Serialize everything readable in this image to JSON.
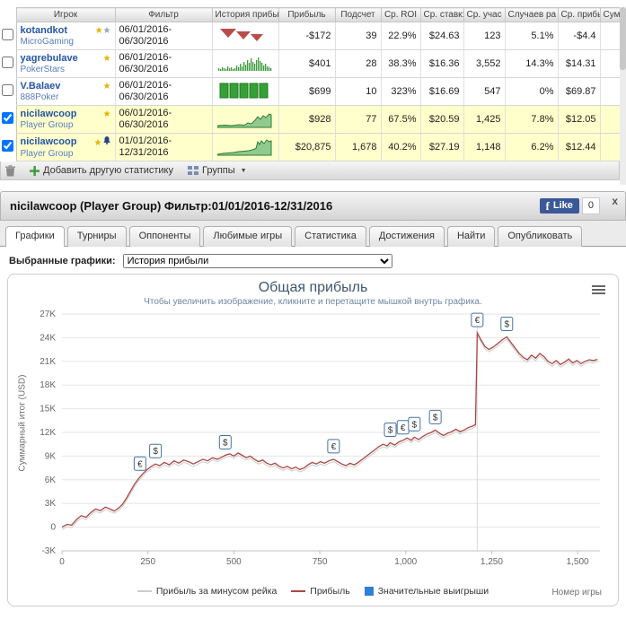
{
  "table": {
    "headers": [
      "Игрок",
      "Фильтр",
      "История прибы",
      "Прибыль",
      "Подсчет",
      "Ср. ROI",
      "Ср. ставк:",
      "Ср. учас",
      "Случаев ра",
      "Ср. прибы",
      "Сумм"
    ],
    "rows": [
      {
        "name": "kotandkot",
        "site": "MicroGaming",
        "icons": [
          "gold-star",
          "gray-star"
        ],
        "filter": "06/01/2016-06/30/2016",
        "spark": "red-wedges",
        "checked": false,
        "neg": [
          "profit",
          "avg_profit"
        ],
        "cells": {
          "profit": "-$172",
          "count": "39",
          "roi": "22.9%",
          "stake": "$24.63",
          "entrants": "123",
          "overlay": "5.1%",
          "avg_profit": "-$4.4",
          "sum": ""
        }
      },
      {
        "name": "yagrebulave",
        "site": "PokerStars",
        "icons": [
          "gold-star"
        ],
        "filter": "06/01/2016-06/30/2016",
        "spark": "green-bars",
        "checked": false,
        "neg": [],
        "cells": {
          "profit": "$401",
          "count": "28",
          "roi": "38.3%",
          "stake": "$16.36",
          "entrants": "3,552",
          "overlay": "14.3%",
          "avg_profit": "$14.31",
          "sum": ""
        }
      },
      {
        "name": "V.Balaev",
        "site": "888Poker",
        "icons": [
          "gold-star"
        ],
        "filter": "06/01/2016-06/30/2016",
        "spark": "green-blocks",
        "checked": false,
        "neg": [],
        "cells": {
          "profit": "$699",
          "count": "10",
          "roi": "323%",
          "stake": "$16.69",
          "entrants": "547",
          "overlay": "0%",
          "avg_profit": "$69.87",
          "sum": ""
        }
      },
      {
        "name": "nicilawcoop",
        "site": "Player Group",
        "icons": [
          "gold-star"
        ],
        "filter": "06/01/2016-06/30/2016",
        "spark": "area-a",
        "checked": true,
        "neg": [],
        "cells": {
          "profit": "$928",
          "count": "77",
          "roi": "67.5%",
          "stake": "$20.59",
          "entrants": "1,425",
          "overlay": "7.8%",
          "avg_profit": "$12.05",
          "sum": ""
        }
      },
      {
        "name": "nicilawcoop",
        "site": "Player Group",
        "icons": [
          "gold-star",
          "bell"
        ],
        "filter": "01/01/2016-12/31/2016",
        "spark": "area-b",
        "checked": true,
        "neg": [],
        "cells": {
          "profit": "$20,875",
          "count": "1,678",
          "roi": "40.2%",
          "stake": "$27.19",
          "entrants": "1,148",
          "overlay": "6.2%",
          "avg_profit": "$12.44",
          "sum": ""
        }
      }
    ]
  },
  "toolbar": {
    "add_label": "Добавить другую статистику",
    "groups_label": "Группы"
  },
  "panel": {
    "title": "nicilawcoop (Player Group) Фильтр:01/01/2016-12/31/2016",
    "like_f": "f",
    "like_label": "Like",
    "like_count": "0",
    "close_label": "x",
    "tabs": [
      "Графики",
      "Турниры",
      "Оппоненты",
      "Любимые игры",
      "Статистика",
      "Достижения",
      "Найти",
      "Опубликовать"
    ],
    "active_tab": "Графики",
    "selector_label": "Выбранные графики:",
    "selector_value": "История прибыли"
  },
  "chart_data": {
    "type": "line",
    "title": "Общая прибыль",
    "subtitle": "Чтобы увеличить изображение, кликните и перетащите мышкой внутрь графика.",
    "ylabel": "Суммарный итог (USD)",
    "xlabel": "Номер игры",
    "xlim": [
      0,
      1565
    ],
    "ylim": [
      -3000,
      27000
    ],
    "yticks": [
      {
        "v": -3000,
        "label": "-3K"
      },
      {
        "v": 0,
        "label": "0"
      },
      {
        "v": 3000,
        "label": "3K"
      },
      {
        "v": 6000,
        "label": "6K"
      },
      {
        "v": 9000,
        "label": "9K"
      },
      {
        "v": 12000,
        "label": "12K"
      },
      {
        "v": 15000,
        "label": "15K"
      },
      {
        "v": 18000,
        "label": "18K"
      },
      {
        "v": 21000,
        "label": "21K"
      },
      {
        "v": 24000,
        "label": "24K"
      },
      {
        "v": 27000,
        "label": "27K"
      }
    ],
    "xticks": [
      {
        "v": 0,
        "label": "0"
      },
      {
        "v": 250,
        "label": "250"
      },
      {
        "v": 500,
        "label": "500"
      },
      {
        "v": 750,
        "label": "750"
      },
      {
        "v": 1000,
        "label": "1,000"
      },
      {
        "v": 1250,
        "label": "1,250"
      },
      {
        "v": 1500,
        "label": "1,500"
      }
    ],
    "vline_x": 1208,
    "marker_border": "#4572A7",
    "series": [
      {
        "name": "Прибыль за минусом рейка",
        "color": "#CCCCCC",
        "offset": -300,
        "width": 1
      },
      {
        "name": "Прибыль",
        "color": "#AA4643",
        "offset": 0,
        "width": 1.3
      }
    ],
    "points": [
      [
        0,
        0
      ],
      [
        15,
        350
      ],
      [
        28,
        250
      ],
      [
        42,
        950
      ],
      [
        56,
        1450
      ],
      [
        70,
        1250
      ],
      [
        84,
        1850
      ],
      [
        98,
        2300
      ],
      [
        112,
        2100
      ],
      [
        126,
        2550
      ],
      [
        140,
        2300
      ],
      [
        152,
        2050
      ],
      [
        164,
        2400
      ],
      [
        176,
        2900
      ],
      [
        188,
        3700
      ],
      [
        200,
        4600
      ],
      [
        212,
        5500
      ],
      [
        224,
        6200
      ],
      [
        236,
        6800
      ],
      [
        248,
        7300
      ],
      [
        260,
        7700
      ],
      [
        272,
        8000
      ],
      [
        284,
        7800
      ],
      [
        298,
        8200
      ],
      [
        312,
        7900
      ],
      [
        326,
        8400
      ],
      [
        340,
        8100
      ],
      [
        354,
        8500
      ],
      [
        368,
        8300
      ],
      [
        382,
        8000
      ],
      [
        396,
        8300
      ],
      [
        410,
        8600
      ],
      [
        424,
        8400
      ],
      [
        438,
        8800
      ],
      [
        452,
        8600
      ],
      [
        466,
        8900
      ],
      [
        475,
        9100
      ],
      [
        488,
        9300
      ],
      [
        500,
        9000
      ],
      [
        512,
        9400
      ],
      [
        524,
        9100
      ],
      [
        536,
        8800
      ],
      [
        548,
        9000
      ],
      [
        560,
        8600
      ],
      [
        572,
        8300
      ],
      [
        584,
        8500
      ],
      [
        596,
        8100
      ],
      [
        608,
        7900
      ],
      [
        620,
        8100
      ],
      [
        632,
        7700
      ],
      [
        644,
        7500
      ],
      [
        656,
        7700
      ],
      [
        668,
        7400
      ],
      [
        680,
        7600
      ],
      [
        692,
        7300
      ],
      [
        704,
        7500
      ],
      [
        716,
        7900
      ],
      [
        728,
        8200
      ],
      [
        740,
        8000
      ],
      [
        752,
        8300
      ],
      [
        764,
        8100
      ],
      [
        776,
        8400
      ],
      [
        790,
        8600
      ],
      [
        802,
        8300
      ],
      [
        814,
        8000
      ],
      [
        826,
        7800
      ],
      [
        838,
        8100
      ],
      [
        850,
        7900
      ],
      [
        862,
        8200
      ],
      [
        874,
        8600
      ],
      [
        886,
        9000
      ],
      [
        898,
        9400
      ],
      [
        910,
        9800
      ],
      [
        922,
        10200
      ],
      [
        934,
        10500
      ],
      [
        946,
        10300
      ],
      [
        955,
        10700
      ],
      [
        968,
        10400
      ],
      [
        980,
        10800
      ],
      [
        992,
        11000
      ],
      [
        1004,
        11300
      ],
      [
        1016,
        11000
      ],
      [
        1025,
        11400
      ],
      [
        1038,
        11100
      ],
      [
        1050,
        11500
      ],
      [
        1062,
        11800
      ],
      [
        1074,
        12000
      ],
      [
        1086,
        12300
      ],
      [
        1098,
        11900
      ],
      [
        1110,
        11600
      ],
      [
        1122,
        11900
      ],
      [
        1134,
        12100
      ],
      [
        1146,
        12400
      ],
      [
        1158,
        12100
      ],
      [
        1170,
        12300
      ],
      [
        1182,
        12600
      ],
      [
        1194,
        12800
      ],
      [
        1203,
        13000
      ],
      [
        1208,
        24600
      ],
      [
        1218,
        23800
      ],
      [
        1230,
        22900
      ],
      [
        1242,
        22500
      ],
      [
        1254,
        22800
      ],
      [
        1266,
        23200
      ],
      [
        1280,
        23700
      ],
      [
        1294,
        24100
      ],
      [
        1306,
        23400
      ],
      [
        1318,
        22700
      ],
      [
        1330,
        22000
      ],
      [
        1342,
        21500
      ],
      [
        1354,
        21200
      ],
      [
        1366,
        21800
      ],
      [
        1378,
        21400
      ],
      [
        1390,
        22000
      ],
      [
        1402,
        21600
      ],
      [
        1414,
        21000
      ],
      [
        1426,
        20700
      ],
      [
        1438,
        21100
      ],
      [
        1450,
        20600
      ],
      [
        1462,
        20900
      ],
      [
        1474,
        21300
      ],
      [
        1486,
        20800
      ],
      [
        1498,
        21100
      ],
      [
        1510,
        20700
      ],
      [
        1522,
        21000
      ],
      [
        1534,
        21200
      ],
      [
        1546,
        21100
      ],
      [
        1558,
        21250
      ]
    ],
    "markers": [
      {
        "x": 227,
        "y": 6400,
        "symbol": "€"
      },
      {
        "x": 272,
        "y": 8000,
        "symbol": "$"
      },
      {
        "x": 475,
        "y": 9100,
        "symbol": "$"
      },
      {
        "x": 790,
        "y": 8600,
        "symbol": "€"
      },
      {
        "x": 955,
        "y": 10700,
        "symbol": "$"
      },
      {
        "x": 992,
        "y": 11000,
        "symbol": "€"
      },
      {
        "x": 1025,
        "y": 11400,
        "symbol": "$"
      },
      {
        "x": 1086,
        "y": 12300,
        "symbol": "$"
      },
      {
        "x": 1208,
        "y": 24600,
        "symbol": "€"
      },
      {
        "x": 1294,
        "y": 24100,
        "symbol": "$"
      }
    ],
    "legend": [
      {
        "label": "Прибыль за минусом рейка",
        "swatch": "line",
        "color": "#CCCCCC"
      },
      {
        "label": "Прибыль",
        "swatch": "line",
        "color": "#AA4643"
      },
      {
        "label": "Значительные выигрыши",
        "swatch": "square",
        "color": "#2F7ED8"
      }
    ]
  }
}
